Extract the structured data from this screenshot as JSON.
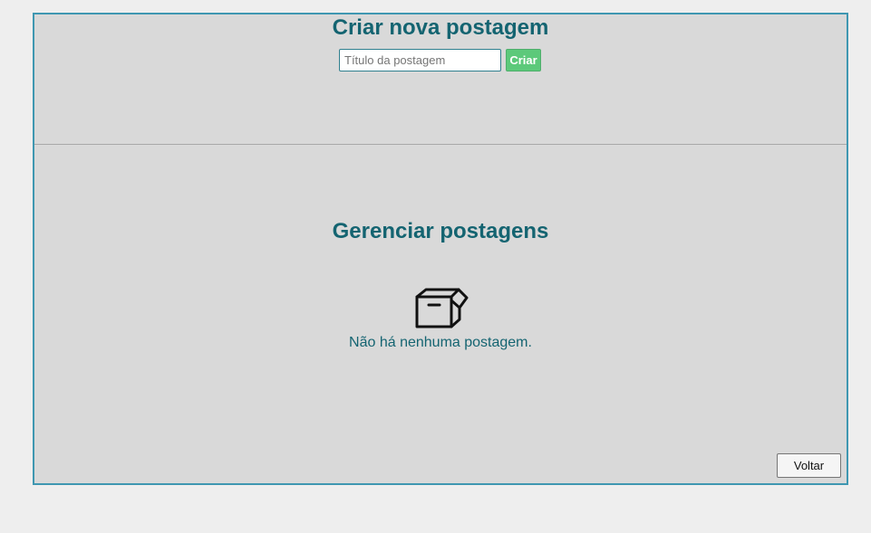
{
  "create": {
    "title": "Criar nova postagem",
    "input_placeholder": "Título da postagem",
    "input_value": "",
    "button_label": "Criar"
  },
  "manage": {
    "title": "Gerenciar postagens",
    "empty_icon": "empty-box-icon",
    "empty_message": "Não há nenhuma postagem."
  },
  "footer": {
    "back_label": "Voltar"
  },
  "colors": {
    "heading": "#146471",
    "panel_border": "#3f97b1",
    "create_button": "#5cc97a"
  }
}
